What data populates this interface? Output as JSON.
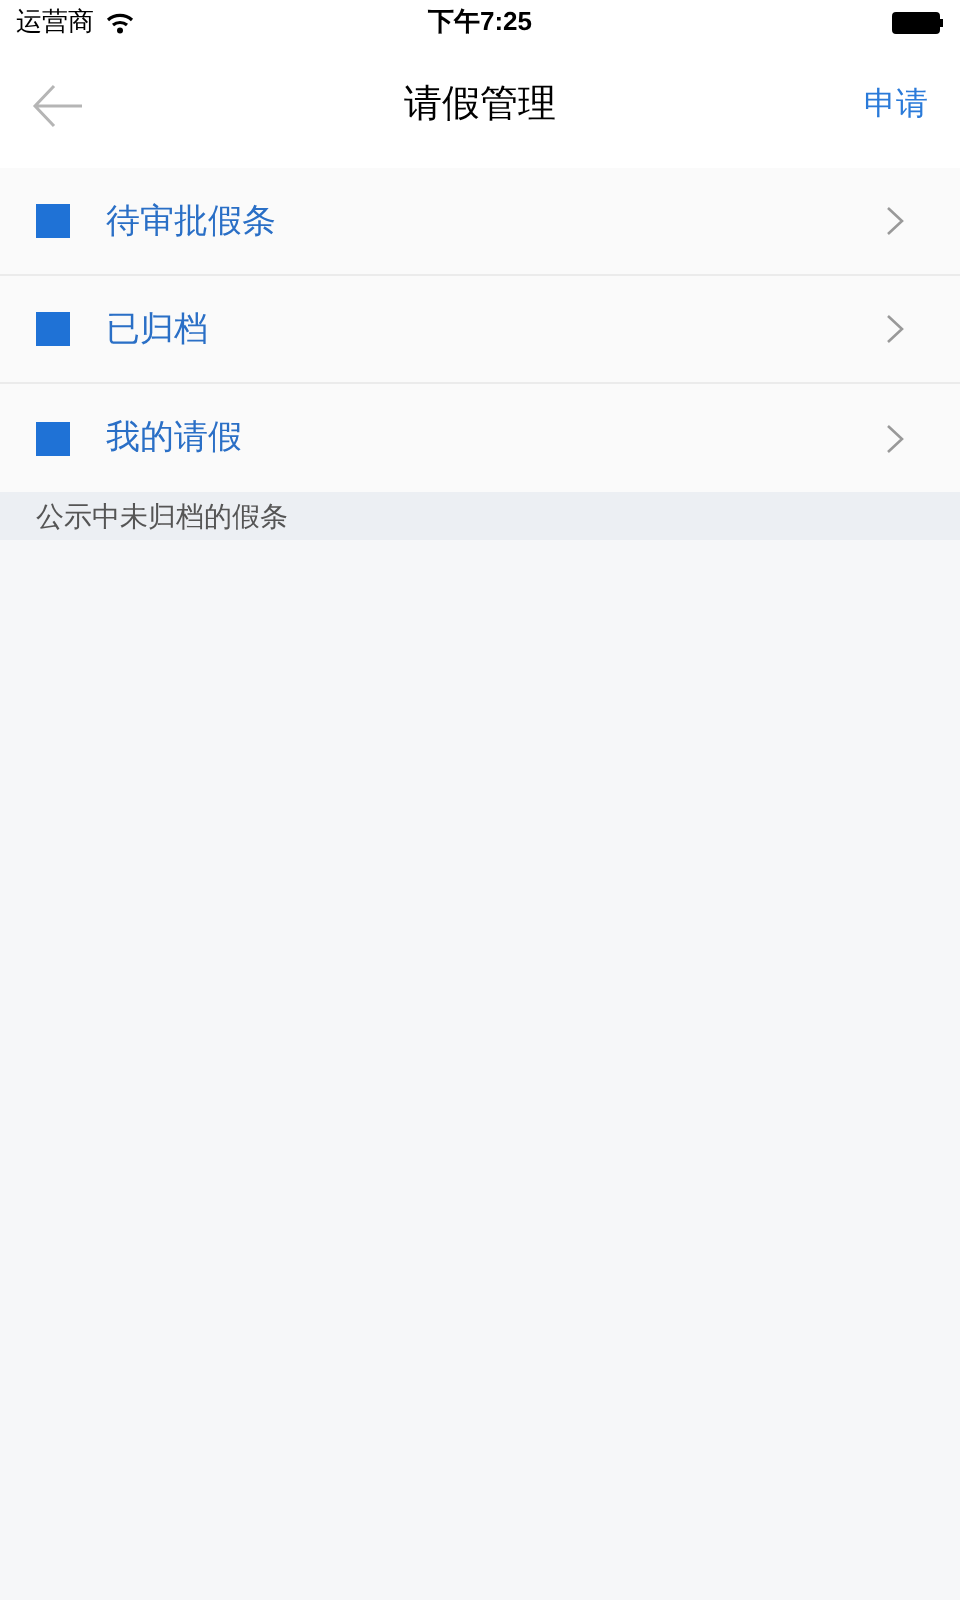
{
  "status_bar": {
    "carrier": "运营商",
    "time": "下午7:25"
  },
  "nav_bar": {
    "title": "请假管理",
    "action": "申请"
  },
  "menu": [
    {
      "label": "待审批假条"
    },
    {
      "label": "已归档"
    },
    {
      "label": "我的请假"
    }
  ],
  "section_header": "公示中未归档的假条"
}
